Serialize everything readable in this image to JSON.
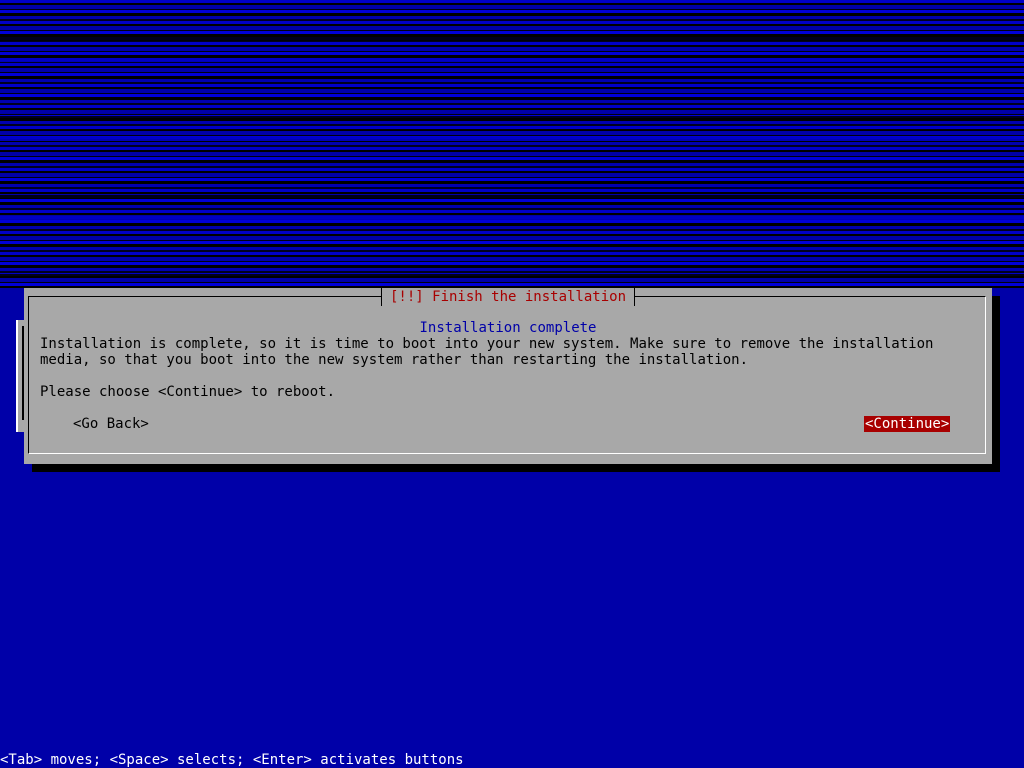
{
  "dialog": {
    "title": "[!!] Finish the installation",
    "subtitle": "Installation complete",
    "message": "Installation is complete, so it is time to boot into your new system. Make sure to remove the installation media, so that you boot into the new system rather than restarting the installation.",
    "prompt": "Please choose <Continue> to reboot.",
    "buttons": {
      "back": "<Go Back>",
      "continue": "<Continue>"
    }
  },
  "status_bar": {
    "text": "<Tab> moves; <Space> selects; <Enter> activates buttons"
  },
  "colors": {
    "background": "#0000a8",
    "dialog_bg": "#a8a8a8",
    "title_red": "#a80000",
    "subtitle_blue": "#0000a8",
    "selected_button_bg": "#a80000"
  }
}
